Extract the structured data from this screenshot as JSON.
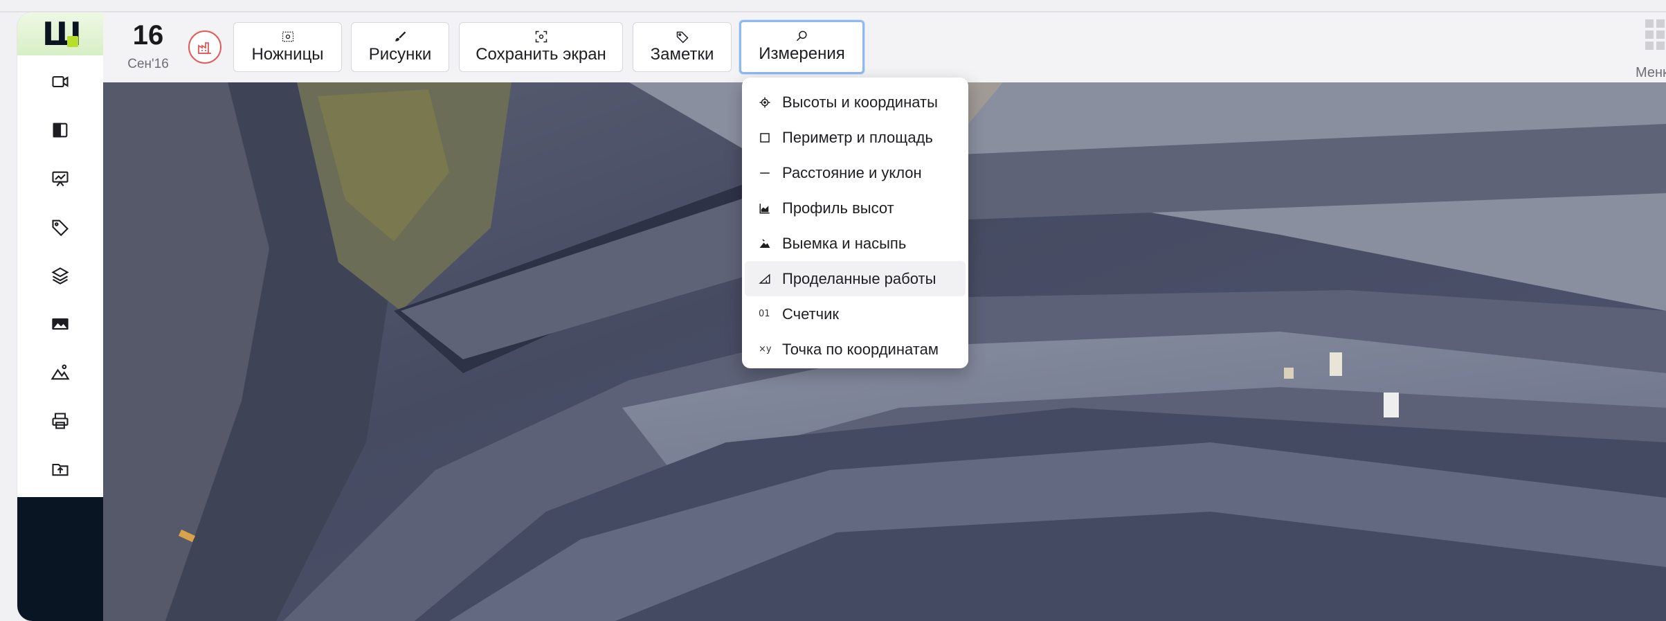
{
  "app": {
    "logo_text": "Ш",
    "accent_color": "#b7de2a",
    "sidebar_dark_color": "#0a1524"
  },
  "sidebar": {
    "items": [
      {
        "name": "video-icon"
      },
      {
        "name": "compare-icon"
      },
      {
        "name": "presentation-chart-icon"
      },
      {
        "name": "tag-icon"
      },
      {
        "name": "layers-icon"
      },
      {
        "name": "image-icon"
      },
      {
        "name": "mountains-icon"
      },
      {
        "name": "printer-icon"
      },
      {
        "name": "folder-upload-icon"
      }
    ]
  },
  "header": {
    "date_day": "16",
    "date_month": "Сен'16",
    "alert_icon": "factory-icon",
    "alert_color": "#e25a5a",
    "tools": [
      {
        "label": "Ножницы",
        "icon": "scissors-screenshot-icon"
      },
      {
        "label": "Рисунки",
        "icon": "brush-icon"
      },
      {
        "label": "Сохранить экран",
        "icon": "screen-capture-icon"
      },
      {
        "label": "Заметки",
        "icon": "tag-icon"
      },
      {
        "label": "Измерения",
        "icon": "measure-search-icon",
        "active": true
      }
    ],
    "menu_label": "Менк"
  },
  "measure_menu": {
    "items": [
      {
        "label": "Высоты и координаты",
        "icon": "crosshair-icon"
      },
      {
        "label": "Периметр и площадь",
        "icon": "square-icon"
      },
      {
        "label": "Расстояние и уклон",
        "icon": "line-icon"
      },
      {
        "label": "Профиль высот",
        "icon": "area-chart-icon"
      },
      {
        "label": "Выемка и насыпь",
        "icon": "cut-fill-icon"
      },
      {
        "label": "Проделанные работы",
        "icon": "slope-icon",
        "highlighted": true
      },
      {
        "label": "Счетчик",
        "icon_text": "01"
      },
      {
        "label": "Точка по координатам",
        "icon_text": "×y"
      }
    ]
  }
}
